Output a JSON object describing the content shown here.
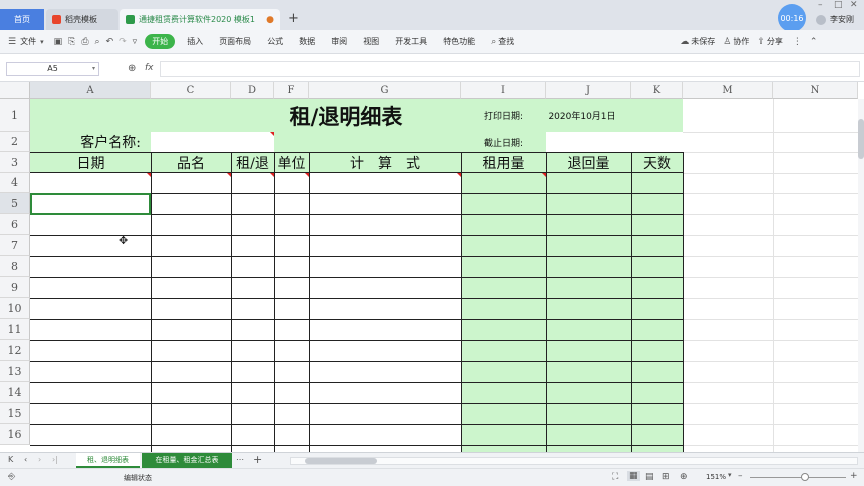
{
  "titlebar": {
    "home_tab": "首页",
    "docer_tab": "稻壳模板",
    "doc_tab": "通捷租赁费计算软件2020 模板1",
    "new_tab": "+",
    "timer": "00:16",
    "user": "李安刚"
  },
  "menubar": {
    "file": "文件",
    "items": [
      "开始",
      "插入",
      "页面布局",
      "公式",
      "数据",
      "审阅",
      "视图",
      "开发工具",
      "特色功能"
    ],
    "search": "查找",
    "unsaved": "未保存",
    "collab": "协作",
    "share": "分享"
  },
  "formula": {
    "cell_ref": "A5",
    "fx": "fx",
    "value": ""
  },
  "columns": [
    "A",
    "C",
    "D",
    "F",
    "G",
    "I",
    "J",
    "K",
    "M",
    "N"
  ],
  "rows": [
    "1",
    "2",
    "3",
    "4",
    "5",
    "6",
    "7",
    "8",
    "9",
    "10",
    "11",
    "12",
    "13",
    "14",
    "15",
    "16"
  ],
  "sheet": {
    "title": "租/退明细表",
    "print_date_label": "打印日期:",
    "print_date_value": "2020年10月1日",
    "customer_label": "客户名称:",
    "cutoff_label": "截止日期:",
    "headers": [
      "日期",
      "品名",
      "租/退",
      "单位",
      "计　算　式",
      "租用量",
      "退回量",
      "天数"
    ]
  },
  "sheet_tabs": [
    "租、退明细表",
    "在租量、租金汇总表"
  ],
  "status": {
    "mode": "编辑状态",
    "zoom": "151%"
  },
  "colors": {
    "green_fill": "#ccf5cc",
    "active_tab": "#2e8b3a",
    "home_blue": "#4a7fe0"
  }
}
